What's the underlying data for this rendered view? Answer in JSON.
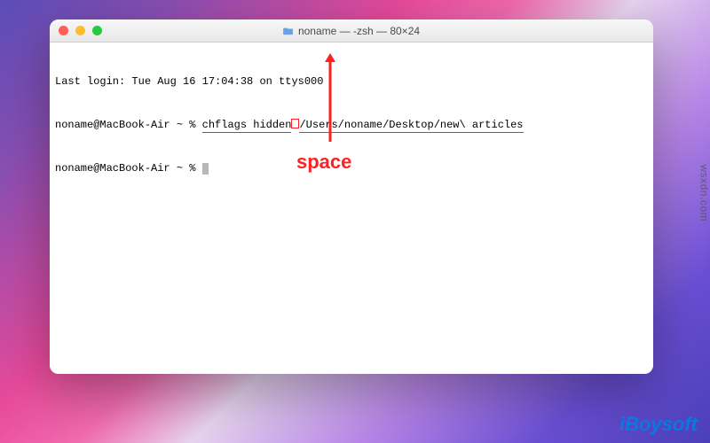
{
  "window": {
    "title": "noname — -zsh — 80×24"
  },
  "terminal": {
    "login_line": "Last login: Tue Aug 16 17:04:38 on ttys000",
    "prompt1_prefix": "noname@MacBook-Air ~ % ",
    "cmd_part1": "chflags hidden",
    "cmd_part2": "/Users/noname/Desktop/new\\ articles",
    "prompt2": "noname@MacBook-Air ~ % "
  },
  "annotation": {
    "label": "space"
  },
  "brand": {
    "prefix": "i",
    "name": "Boysoft"
  },
  "watermark": "wsxdn.com",
  "colors": {
    "highlight": "#ff2020",
    "brand_blue": "#0b78e0"
  }
}
